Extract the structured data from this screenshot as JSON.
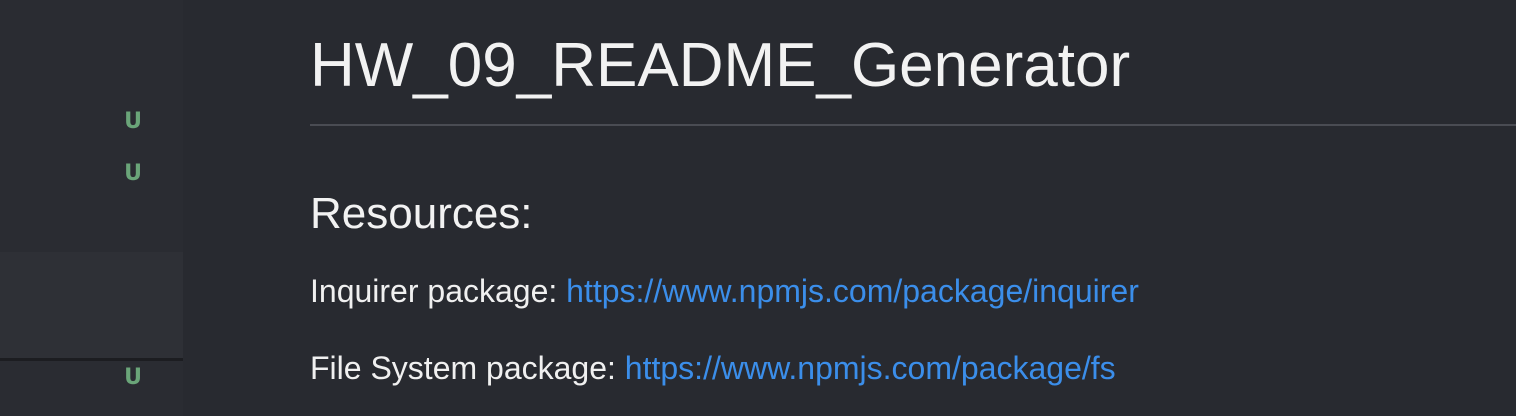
{
  "sidebar": {
    "git_badges": [
      "U",
      "U",
      "U"
    ]
  },
  "readme": {
    "title": "HW_09_README_Generator",
    "resources_heading": "Resources:",
    "resources": [
      {
        "label": "Inquirer package: ",
        "link": "https://www.npmjs.com/package/inquirer"
      },
      {
        "label": "File System package: ",
        "link": "https://www.npmjs.com/package/fs"
      }
    ]
  },
  "colors": {
    "background": "#282a30",
    "sidebar": "#2a2c32",
    "text": "#f2f2f2",
    "link": "#3b8eea",
    "git_untracked": "#6aa579"
  }
}
